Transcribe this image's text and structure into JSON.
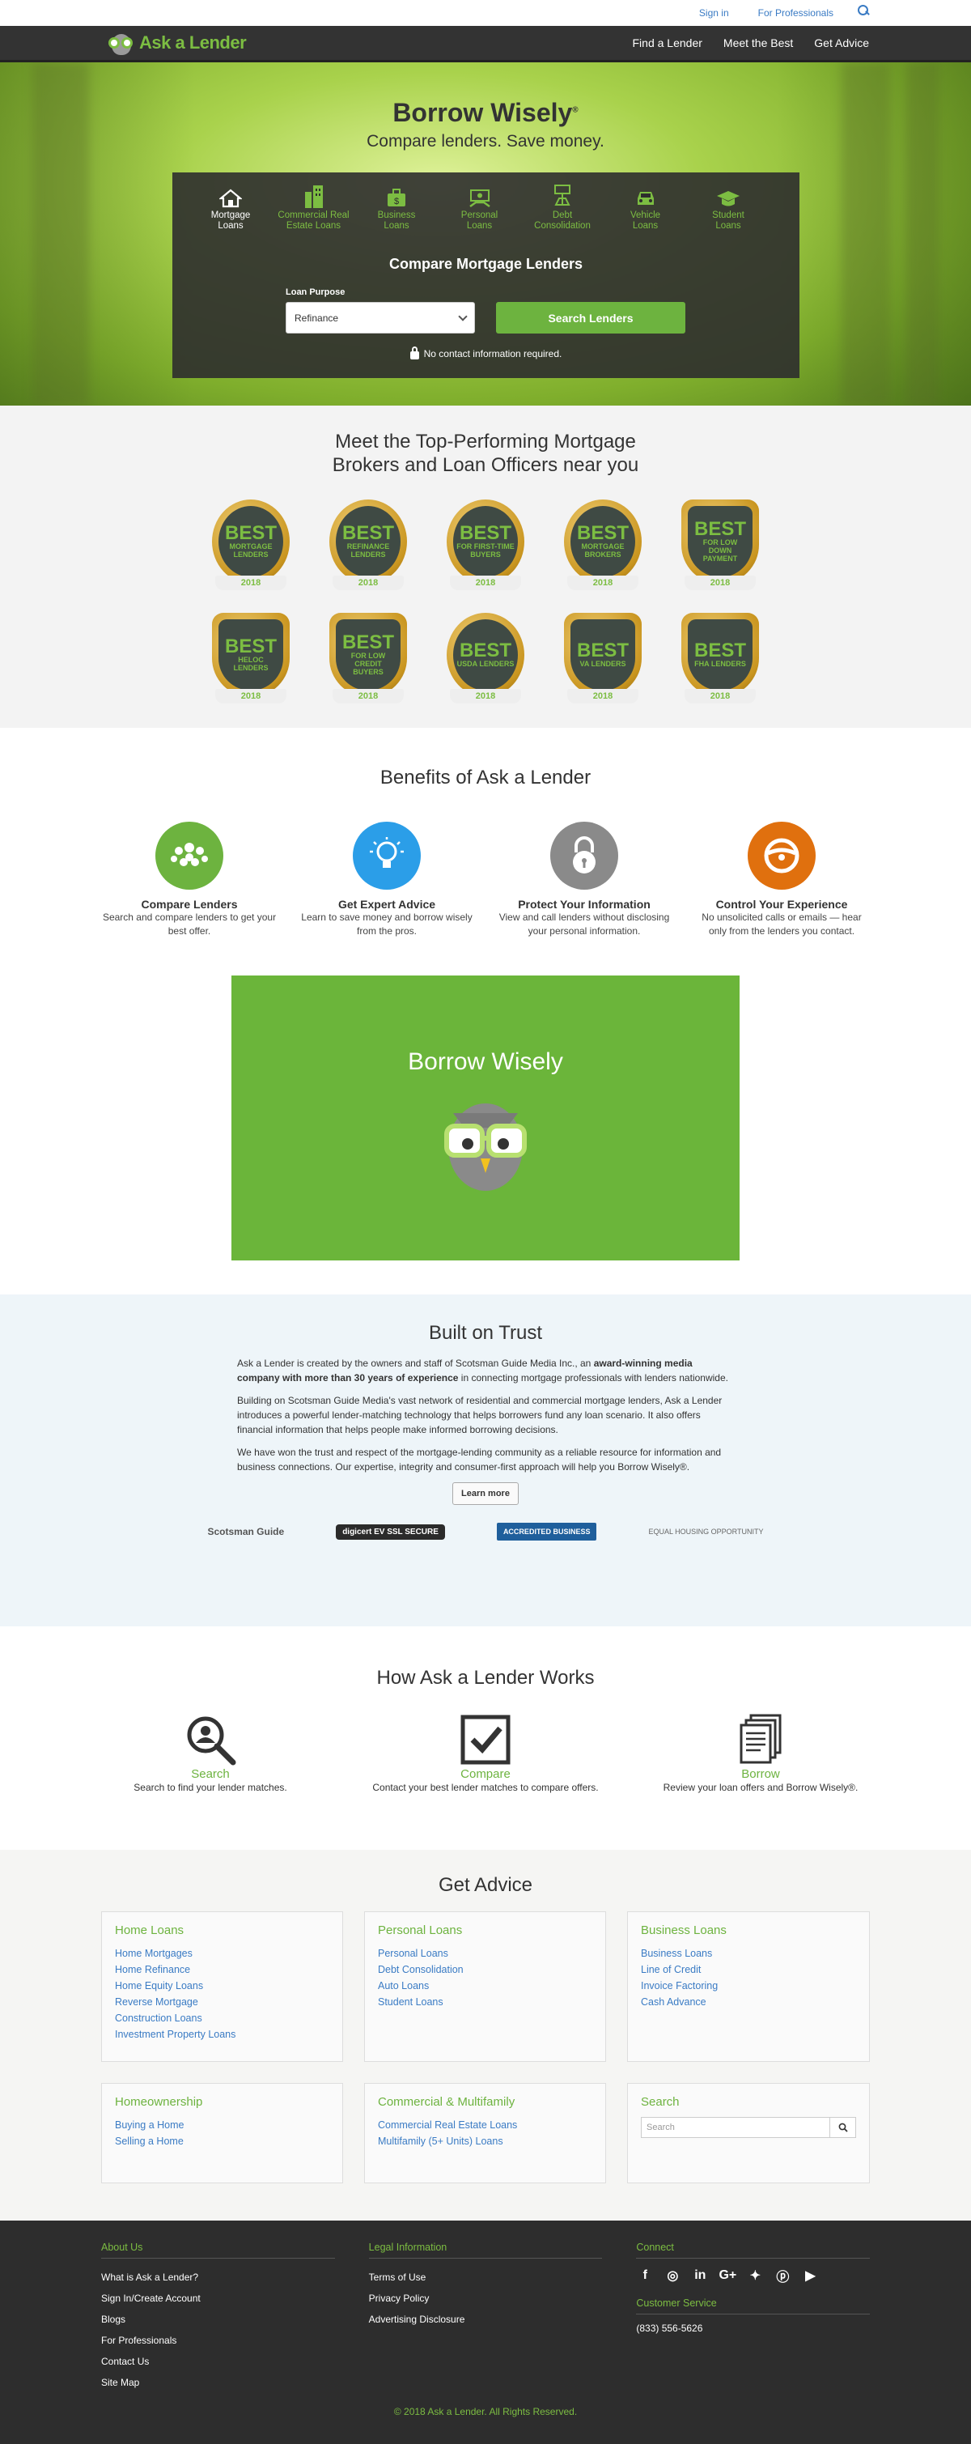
{
  "utilbar": {
    "signin": "Sign in",
    "pros": "For Professionals"
  },
  "nav": {
    "logo": "Ask a Lender",
    "links": [
      "Find a Lender",
      "Meet the Best",
      "Get Advice"
    ]
  },
  "hero": {
    "title": "Borrow Wisely",
    "reg": "®",
    "tagline": "Compare lenders. Save money.",
    "categories": [
      {
        "label": "Mortgage\nLoans",
        "icon": "house-icon"
      },
      {
        "label": "Commercial Real\nEstate Loans",
        "icon": "building-icon"
      },
      {
        "label": "Business\nLoans",
        "icon": "briefcase-icon"
      },
      {
        "label": "Personal\nLoans",
        "icon": "money-icon"
      },
      {
        "label": "Debt\nConsolidation",
        "icon": "scale-icon"
      },
      {
        "label": "Vehicle\nLoans",
        "icon": "car-icon"
      },
      {
        "label": "Student\nLoans",
        "icon": "graduation-cap-icon"
      }
    ],
    "form_title": "Compare Mortgage Lenders",
    "purpose_label": "Loan Purpose",
    "purpose_value": "Refinance",
    "search_button": "Search Lenders",
    "no_contact": "No contact information required."
  },
  "best": {
    "title": "Meet the Top-Performing Mortgage Brokers and Loan Officers near you",
    "badges_row1": [
      {
        "word": "BEST",
        "sub": "MORTGAGE LENDERS",
        "year": "2018"
      },
      {
        "word": "BEST",
        "sub": "REFINANCE LENDERS",
        "year": "2018"
      },
      {
        "word": "BEST",
        "sub": "FOR FIRST-TIME BUYERS",
        "year": "2018"
      },
      {
        "word": "BEST",
        "sub": "MORTGAGE BROKERS",
        "year": "2018"
      },
      {
        "word": "BEST",
        "sub": "FOR LOW DOWN PAYMENT",
        "year": "2018"
      }
    ],
    "badges_row2": [
      {
        "word": "BEST",
        "sub": "HELOC LENDERS",
        "year": "2018"
      },
      {
        "word": "BEST",
        "sub": "FOR LOW CREDIT BUYERS",
        "year": "2018"
      },
      {
        "word": "BEST",
        "sub": "USDA LENDERS",
        "year": "2018"
      },
      {
        "word": "BEST",
        "sub": "VA LENDERS",
        "year": "2018"
      },
      {
        "word": "BEST",
        "sub": "FHA LENDERS",
        "year": "2018"
      }
    ]
  },
  "benefits": {
    "title": "Benefits of Ask a Lender",
    "items": [
      {
        "title": "Compare Lenders",
        "text": "Search and compare lenders to get your best offer.",
        "color": "#6db33f",
        "icon": "people-icon"
      },
      {
        "title": "Get Expert Advice",
        "text": "Learn to save money and borrow wisely from the pros.",
        "color": "#2b9ee8",
        "icon": "lightbulb-icon"
      },
      {
        "title": "Protect Your Information",
        "text": "View and call lenders without disclosing your personal information.",
        "color": "#8a8a8a",
        "icon": "padlock-icon"
      },
      {
        "title": "Control Your Experience",
        "text": "No unsolicited calls or emails — hear only from the lenders you contact.",
        "color": "#e0700e",
        "icon": "steering-wheel-icon"
      }
    ],
    "video_title": "Borrow Wisely"
  },
  "trust": {
    "title": "Built on Trust",
    "p1_a": "Ask a Lender is created by the owners and staff of Scotsman Guide Media Inc., an ",
    "p1_b": "award-winning media company with more than 30 years of experience",
    "p1_c": " in connecting mortgage professionals with lenders nationwide.",
    "p2": "Building on Scotsman Guide Media's vast network of residential and commercial mortgage lenders, Ask a Lender introduces a powerful lender-matching technology that helps borrowers fund any loan scenario. It also offers financial information that helps people make informed borrowing decisions.",
    "p3": "We have won the trust and respect of the mortgage-lending community as a reliable resource for information and business connections. Our expertise, integrity and consumer-first approach will help you Borrow Wisely®.",
    "learn_more": "Learn more",
    "logos": [
      "Scotsman Guide",
      "digicert EV SSL SECURE",
      "ACCREDITED BUSINESS",
      "EQUAL HOUSING OPPORTUNITY"
    ]
  },
  "how": {
    "title": "How Ask a Lender Works",
    "steps": [
      {
        "title": "Search",
        "text": "Search to find your lender matches."
      },
      {
        "title": "Compare",
        "text": "Contact your best lender matches to compare offers."
      },
      {
        "title": "Borrow",
        "text": "Review your loan offers and Borrow Wisely®."
      }
    ]
  },
  "advice": {
    "title": "Get Advice",
    "cards": [
      {
        "title": "Home Loans",
        "links": [
          "Home Mortgages",
          "Home Refinance",
          "Home Equity Loans",
          "Reverse Mortgage",
          "Construction Loans",
          "Investment Property Loans"
        ]
      },
      {
        "title": "Personal Loans",
        "links": [
          "Personal Loans",
          "Debt Consolidation",
          "Auto Loans",
          "Student Loans"
        ]
      },
      {
        "title": "Business Loans",
        "links": [
          "Business Loans",
          "Line of Credit",
          "Invoice Factoring",
          "Cash Advance"
        ]
      },
      {
        "title": "Homeownership",
        "links": [
          "Buying a Home",
          "Selling a Home"
        ]
      },
      {
        "title": "Commercial & Multifamily",
        "links": [
          "Commercial Real Estate Loans",
          "Multifamily (5+ Units) Loans"
        ]
      }
    ],
    "search_title": "Search",
    "search_placeholder": "Search"
  },
  "footer": {
    "about_title": "About Us",
    "about_links": [
      "What is Ask a Lender?",
      "Sign In/Create Account",
      "Blogs",
      "For Professionals",
      "Contact Us",
      "Site Map"
    ],
    "legal_title": "Legal Information",
    "legal_links": [
      "Terms of Use",
      "Privacy Policy",
      "Advertising Disclosure"
    ],
    "connect_title": "Connect",
    "social": [
      "facebook-icon",
      "instagram-icon",
      "linkedin-icon",
      "google-plus-icon",
      "twitter-icon",
      "pinterest-icon",
      "youtube-icon"
    ],
    "service_title": "Customer Service",
    "phone": "(833) 556-5626",
    "copyright": "© 2018 Ask a Lender. All Rights Reserved."
  }
}
